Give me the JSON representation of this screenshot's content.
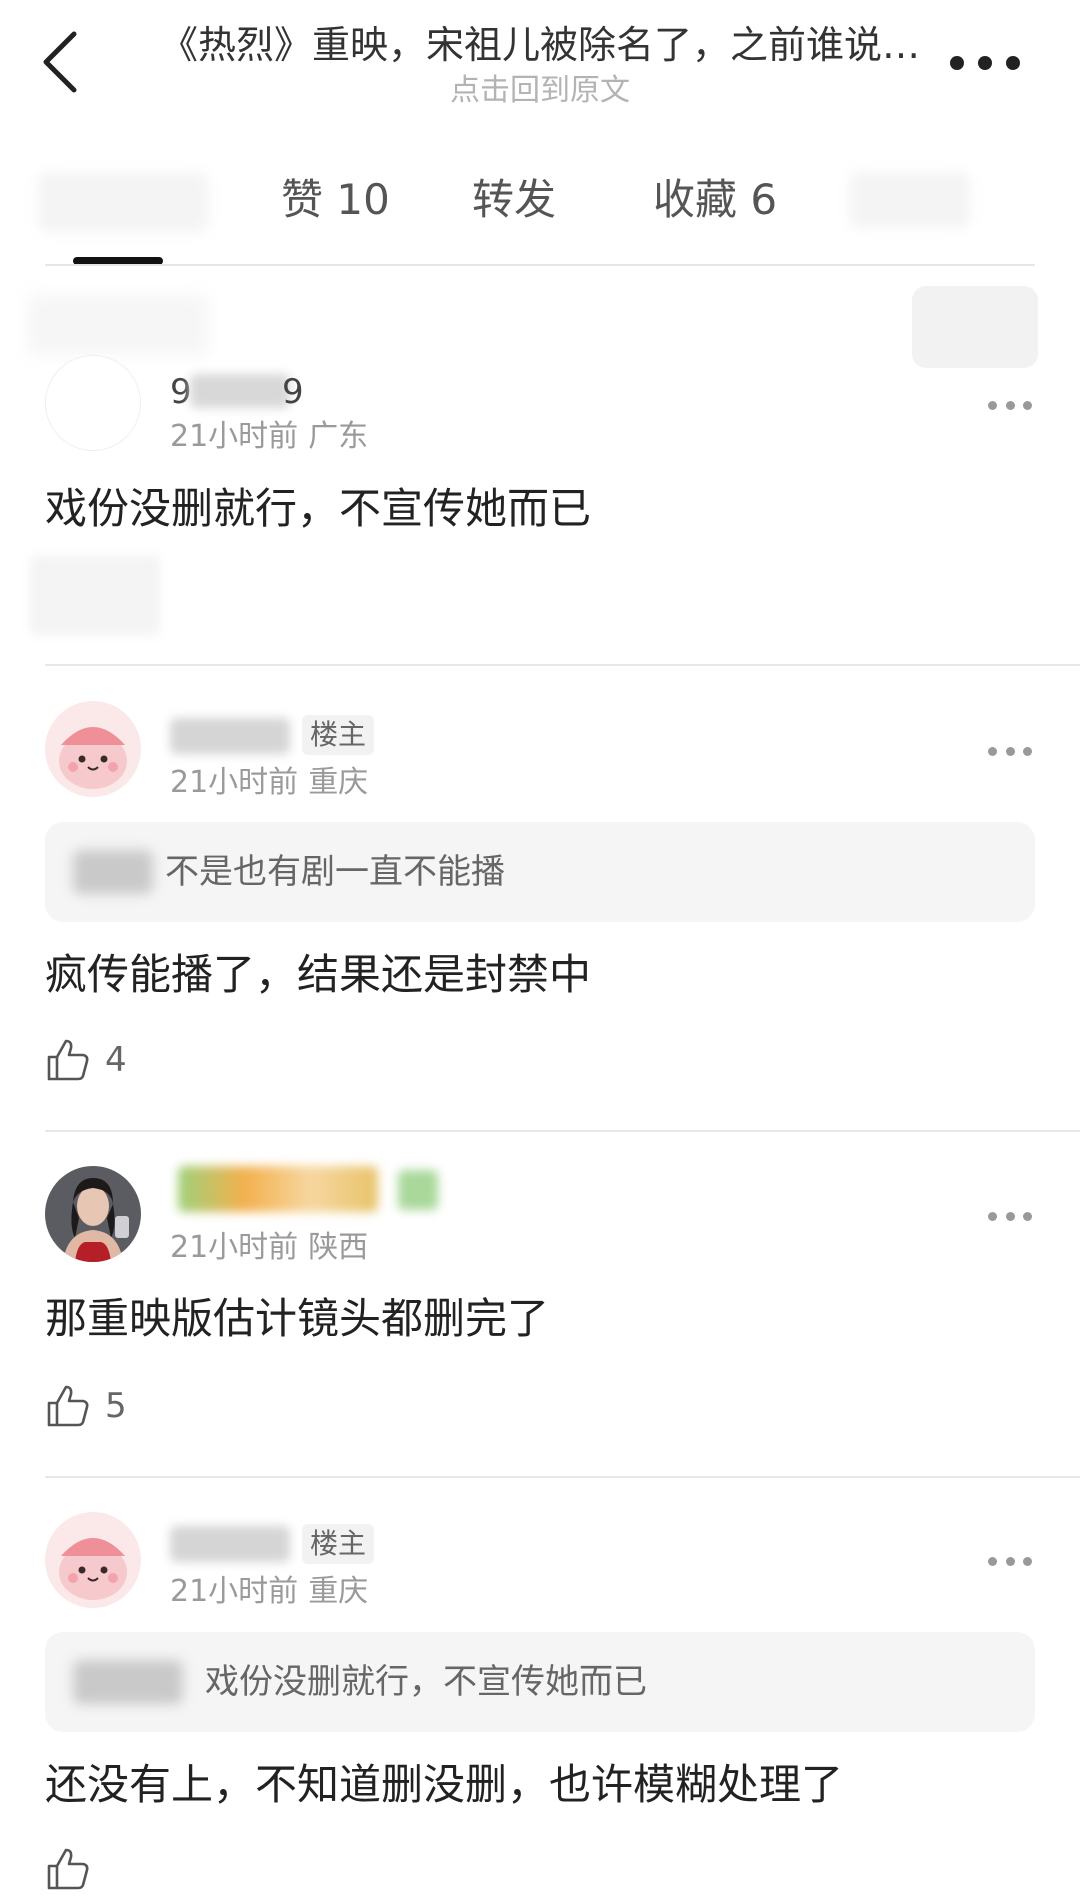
{
  "header": {
    "title": "《热烈》重映，宋祖儿被除名了，之前谁说…",
    "subtitle": "点击回到原文"
  },
  "tabs": [
    {
      "label": "赞 10"
    },
    {
      "label": "转发"
    },
    {
      "label": "收藏 6"
    }
  ],
  "comments": [
    {
      "username": "9",
      "username_end": "9",
      "time": "21小时前",
      "location": "广东",
      "text": "戏份没删就行，不宣传她而已"
    },
    {
      "badge": "楼主",
      "time": "21小时前",
      "location": "重庆",
      "quote": "不是也有剧一直不能播",
      "text": "疯传能播了，结果还是封禁中",
      "likes": "4"
    },
    {
      "time": "21小时前",
      "location": "陕西",
      "text": "那重映版估计镜头都删完了",
      "likes": "5"
    },
    {
      "badge": "楼主",
      "time": "21小时前",
      "location": "重庆",
      "quote": "戏份没删就行，不宣传她而已",
      "text": "还没有上，不知道删没删，也许模糊处理了"
    }
  ],
  "icons": {
    "back": "back-arrow-icon",
    "more": "more-dots-icon",
    "like": "thumbs-up-icon"
  }
}
